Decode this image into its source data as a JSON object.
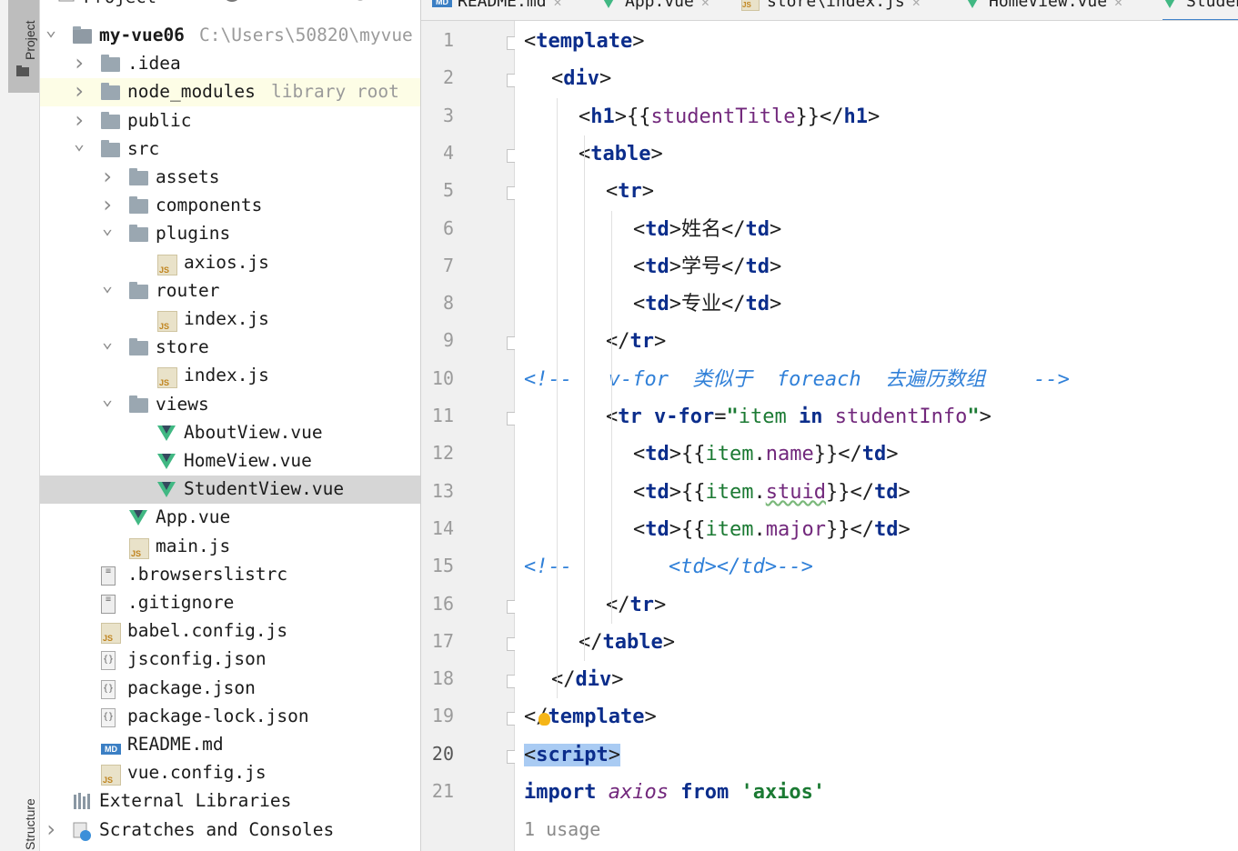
{
  "tool_strip": {
    "project": "Project",
    "structure": "Structure"
  },
  "project_panel": {
    "header": "Project",
    "tree": [
      {
        "indent": 0,
        "arrow": "down",
        "icon": "root-folder",
        "label": "my-vue06",
        "hint": "C:\\Users\\50820\\myvue"
      },
      {
        "indent": 1,
        "arrow": "right",
        "icon": "folder",
        "label": ".idea"
      },
      {
        "indent": 1,
        "arrow": "right",
        "icon": "folder",
        "label": "node_modules",
        "hint": "library root",
        "highlight": "lib"
      },
      {
        "indent": 1,
        "arrow": "right",
        "icon": "folder",
        "label": "public"
      },
      {
        "indent": 1,
        "arrow": "down",
        "icon": "folder",
        "label": "src"
      },
      {
        "indent": 2,
        "arrow": "right",
        "icon": "folder",
        "label": "assets"
      },
      {
        "indent": 2,
        "arrow": "right",
        "icon": "folder",
        "label": "components"
      },
      {
        "indent": 2,
        "arrow": "down",
        "icon": "folder",
        "label": "plugins"
      },
      {
        "indent": 3,
        "arrow": "",
        "icon": "js",
        "label": "axios.js"
      },
      {
        "indent": 2,
        "arrow": "down",
        "icon": "folder",
        "label": "router"
      },
      {
        "indent": 3,
        "arrow": "",
        "icon": "js",
        "label": "index.js"
      },
      {
        "indent": 2,
        "arrow": "down",
        "icon": "folder",
        "label": "store"
      },
      {
        "indent": 3,
        "arrow": "",
        "icon": "js",
        "label": "index.js"
      },
      {
        "indent": 2,
        "arrow": "down",
        "icon": "folder",
        "label": "views"
      },
      {
        "indent": 3,
        "arrow": "",
        "icon": "vue",
        "label": "AboutView.vue"
      },
      {
        "indent": 3,
        "arrow": "",
        "icon": "vue",
        "label": "HomeView.vue"
      },
      {
        "indent": 3,
        "arrow": "",
        "icon": "vue",
        "label": "StudentView.vue",
        "highlight": "sel"
      },
      {
        "indent": 2,
        "arrow": "",
        "icon": "vue",
        "label": "App.vue"
      },
      {
        "indent": 2,
        "arrow": "",
        "icon": "js",
        "label": "main.js"
      },
      {
        "indent": 1,
        "arrow": "",
        "icon": "text",
        "label": ".browserslistrc"
      },
      {
        "indent": 1,
        "arrow": "",
        "icon": "text",
        "label": ".gitignore"
      },
      {
        "indent": 1,
        "arrow": "",
        "icon": "js",
        "label": "babel.config.js"
      },
      {
        "indent": 1,
        "arrow": "",
        "icon": "json",
        "label": "jsconfig.json"
      },
      {
        "indent": 1,
        "arrow": "",
        "icon": "json",
        "label": "package.json"
      },
      {
        "indent": 1,
        "arrow": "",
        "icon": "json",
        "label": "package-lock.json"
      },
      {
        "indent": 1,
        "arrow": "",
        "icon": "md",
        "label": "README.md"
      },
      {
        "indent": 1,
        "arrow": "",
        "icon": "js",
        "label": "vue.config.js"
      },
      {
        "indent": 0,
        "arrow": "",
        "icon": "libraries",
        "label": "External Libraries"
      },
      {
        "indent": 0,
        "arrow": "right",
        "icon": "scratch",
        "label": "Scratches and Consoles"
      }
    ]
  },
  "tabs": [
    {
      "label": "README.md",
      "icon": "md"
    },
    {
      "label": "App.vue",
      "icon": "vue"
    },
    {
      "label": "store\\index.js",
      "icon": "js"
    },
    {
      "label": "HomeView.vue",
      "icon": "vue"
    },
    {
      "label": "StudentView.vue",
      "icon": "vue",
      "active": true
    }
  ],
  "editor": {
    "current_line": 20,
    "usage_hint": "1 usage",
    "lines": [
      {
        "n": "1",
        "indent": 0,
        "html": "<span class='br'>&lt;</span><span class='tg'>template</span><span class='br'>&gt;</span>",
        "fold": "open"
      },
      {
        "n": "2",
        "indent": 1,
        "html": "<span class='br'>&lt;</span><span class='tg'>div</span><span class='br'>&gt;</span>",
        "fold": "open"
      },
      {
        "n": "3",
        "indent": 2,
        "html": "<span class='br'>&lt;</span><span class='tg'>h1</span><span class='br'>&gt;</span>{{<span class='mu'>studentTitle</span>}}<span class='br'>&lt;/</span><span class='tg'>h1</span><span class='br'>&gt;</span>",
        "fold": ""
      },
      {
        "n": "4",
        "indent": 2,
        "html": "<span class='br'>&lt;</span><span class='tg'>table</span><span class='br'>&gt;</span>",
        "fold": "open"
      },
      {
        "n": "5",
        "indent": 3,
        "html": "<span class='br'>&lt;</span><span class='tg'>tr</span><span class='br'>&gt;</span>",
        "fold": "open"
      },
      {
        "n": "6",
        "indent": 4,
        "html": "<span class='br'>&lt;</span><span class='tg'>td</span><span class='br'>&gt;</span>姓名<span class='br'>&lt;/</span><span class='tg'>td</span><span class='br'>&gt;</span>",
        "fold": ""
      },
      {
        "n": "7",
        "indent": 4,
        "html": "<span class='br'>&lt;</span><span class='tg'>td</span><span class='br'>&gt;</span>学号<span class='br'>&lt;/</span><span class='tg'>td</span><span class='br'>&gt;</span>",
        "fold": ""
      },
      {
        "n": "8",
        "indent": 4,
        "html": "<span class='br'>&lt;</span><span class='tg'>td</span><span class='br'>&gt;</span>专业<span class='br'>&lt;/</span><span class='tg'>td</span><span class='br'>&gt;</span>",
        "fold": ""
      },
      {
        "n": "9",
        "indent": 3,
        "html": "<span class='br'>&lt;/</span><span class='tg'>tr</span><span class='br'>&gt;</span>",
        "fold": "close"
      },
      {
        "n": "10",
        "indent": 0,
        "html": "<span class='cm'>&lt;!--   v-for  类似于  foreach  去遍历数组    --&gt;</span>",
        "fold": ""
      },
      {
        "n": "11",
        "indent": 3,
        "html": "<span class='br'>&lt;</span><span class='tg'>tr</span> <span class='kw'>v-for</span>=<span class='st'>\"</span><span style='color:#1b7a33'>item</span> <span class='kw'>in</span> <span class='mu'>studentInfo</span><span class='st'>\"</span><span class='br'>&gt;</span>",
        "fold": "open"
      },
      {
        "n": "12",
        "indent": 4,
        "html": "<span class='br'>&lt;</span><span class='tg'>td</span><span class='br'>&gt;</span>{{<span style='color:#1b7a33'>item</span>.<span class='mu'>name</span>}}<span class='br'>&lt;/</span><span class='tg'>td</span><span class='br'>&gt;</span>",
        "fold": ""
      },
      {
        "n": "13",
        "indent": 4,
        "html": "<span class='br'>&lt;</span><span class='tg'>td</span><span class='br'>&gt;</span>{{<span style='color:#1b7a33'>item</span>.<span class='mu' style='text-decoration:underline wavy #7ab87a'>stuid</span>}}<span class='br'>&lt;/</span><span class='tg'>td</span><span class='br'>&gt;</span>",
        "fold": ""
      },
      {
        "n": "14",
        "indent": 4,
        "html": "<span class='br'>&lt;</span><span class='tg'>td</span><span class='br'>&gt;</span>{{<span style='color:#1b7a33'>item</span>.<span class='mu'>major</span>}}<span class='br'>&lt;/</span><span class='tg'>td</span><span class='br'>&gt;</span>",
        "fold": ""
      },
      {
        "n": "15",
        "indent": 0,
        "html": "<span class='cm'>&lt;!--        &lt;td&gt;&lt;/td&gt;--&gt;</span>",
        "fold": ""
      },
      {
        "n": "16",
        "indent": 3,
        "html": "<span class='br'>&lt;/</span><span class='tg'>tr</span><span class='br'>&gt;</span>",
        "fold": "close"
      },
      {
        "n": "17",
        "indent": 2,
        "html": "<span class='br'>&lt;/</span><span class='tg'>table</span><span class='br'>&gt;</span>",
        "fold": "close"
      },
      {
        "n": "18",
        "indent": 1,
        "html": "<span class='br'>&lt;/</span><span class='tg'>div</span><span class='br'>&gt;</span>",
        "fold": "close"
      },
      {
        "n": "19",
        "indent": 0,
        "html": "<span class='br'>&lt;/</span><span class='tg'>template</span><span class='br'>&gt;</span>",
        "fold": "close"
      },
      {
        "n": "20",
        "indent": 0,
        "html": "<span class='sel-tag'><span class='br'>&lt;</span><span class='tg'>script</span><span class='br'>&gt;</span></span>",
        "fold": "open"
      },
      {
        "n": "21",
        "indent": 0,
        "html": "<span class='kw'>import</span> <span class='ital'>axios</span> <span class='kw'>from</span> <span class='st'>'axios'</span>",
        "fold": ""
      }
    ]
  }
}
